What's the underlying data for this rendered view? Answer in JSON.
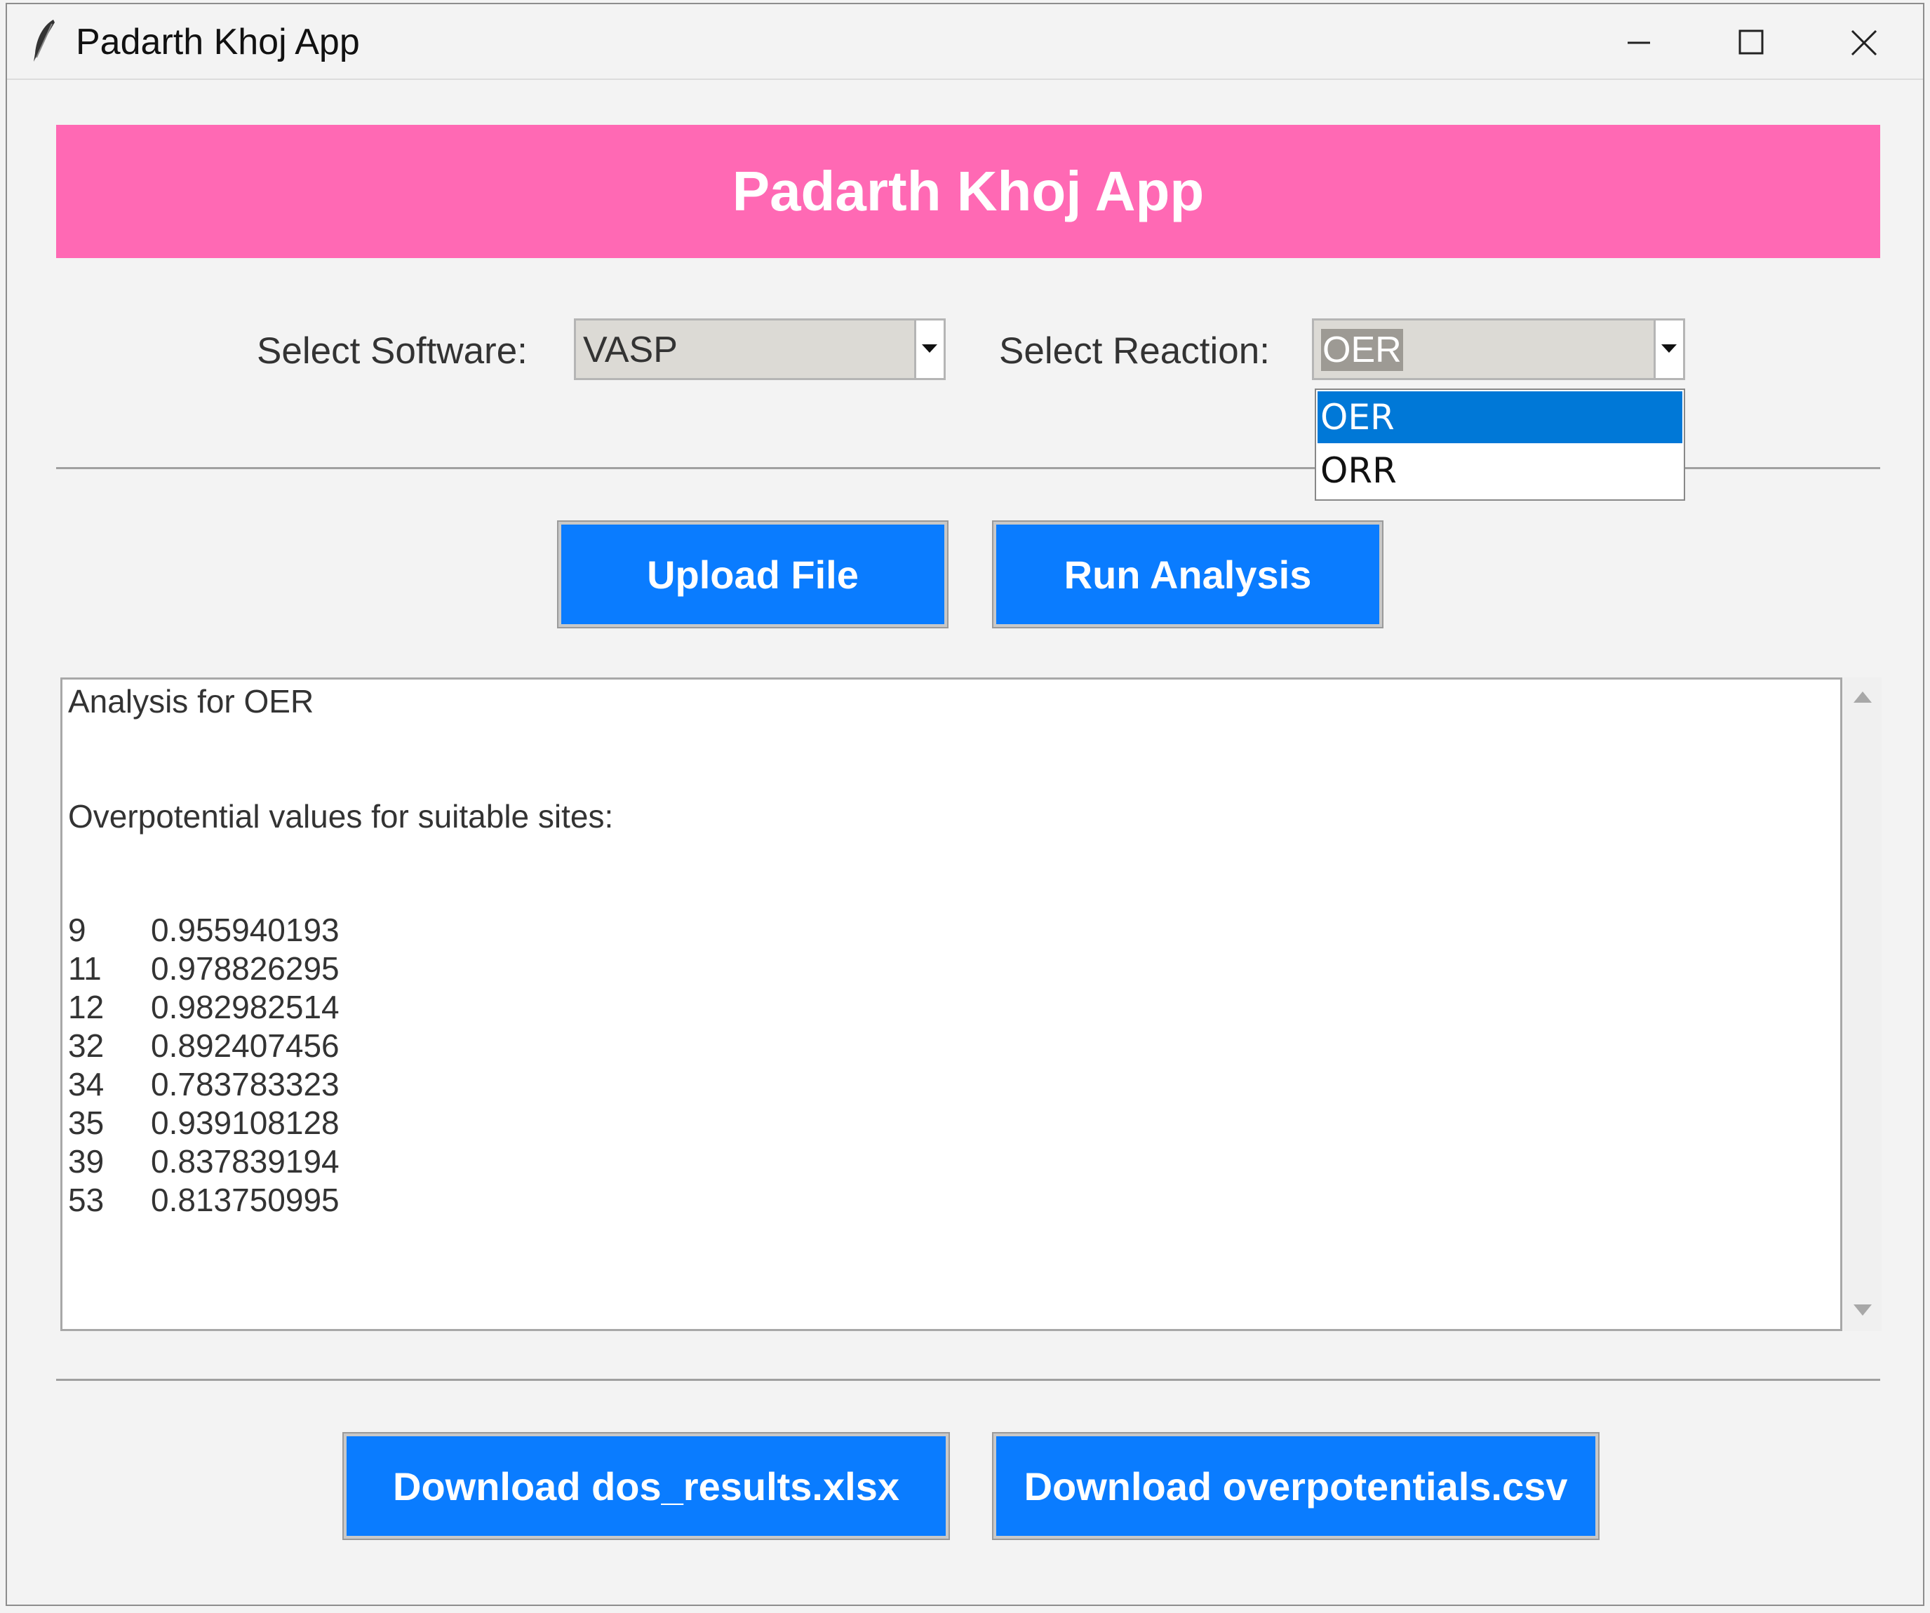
{
  "window": {
    "title": "Padarth Khoj App"
  },
  "banner": {
    "title": "Padarth Khoj App"
  },
  "software": {
    "label": "Select Software:",
    "value": "VASP"
  },
  "reaction": {
    "label": "Select Reaction:",
    "value": "OER",
    "options": [
      "OER",
      "ORR"
    ],
    "selected_option": "OER"
  },
  "actions": {
    "upload": "Upload File",
    "run": "Run Analysis"
  },
  "output": {
    "heading": "Analysis for OER",
    "subheading": "Overpotential values for suitable sites:",
    "rows": [
      {
        "site": "9",
        "value": "0.955940193"
      },
      {
        "site": "11",
        "value": "0.978826295"
      },
      {
        "site": "12",
        "value": "0.982982514"
      },
      {
        "site": "32",
        "value": "0.892407456"
      },
      {
        "site": "34",
        "value": "0.783783323"
      },
      {
        "site": "35",
        "value": "0.939108128"
      },
      {
        "site": "39",
        "value": "0.837839194"
      },
      {
        "site": "53",
        "value": "0.813750995"
      }
    ]
  },
  "downloads": {
    "dos": "Download dos_results.xlsx",
    "overpotentials": "Download overpotentials.csv"
  },
  "colors": {
    "banner": "#ff69b4",
    "button": "#0a7cff",
    "selection": "#0078d7"
  },
  "icons": {
    "app": "feather-icon",
    "minimize": "minimize-icon",
    "maximize": "maximize-icon",
    "close": "close-icon"
  }
}
